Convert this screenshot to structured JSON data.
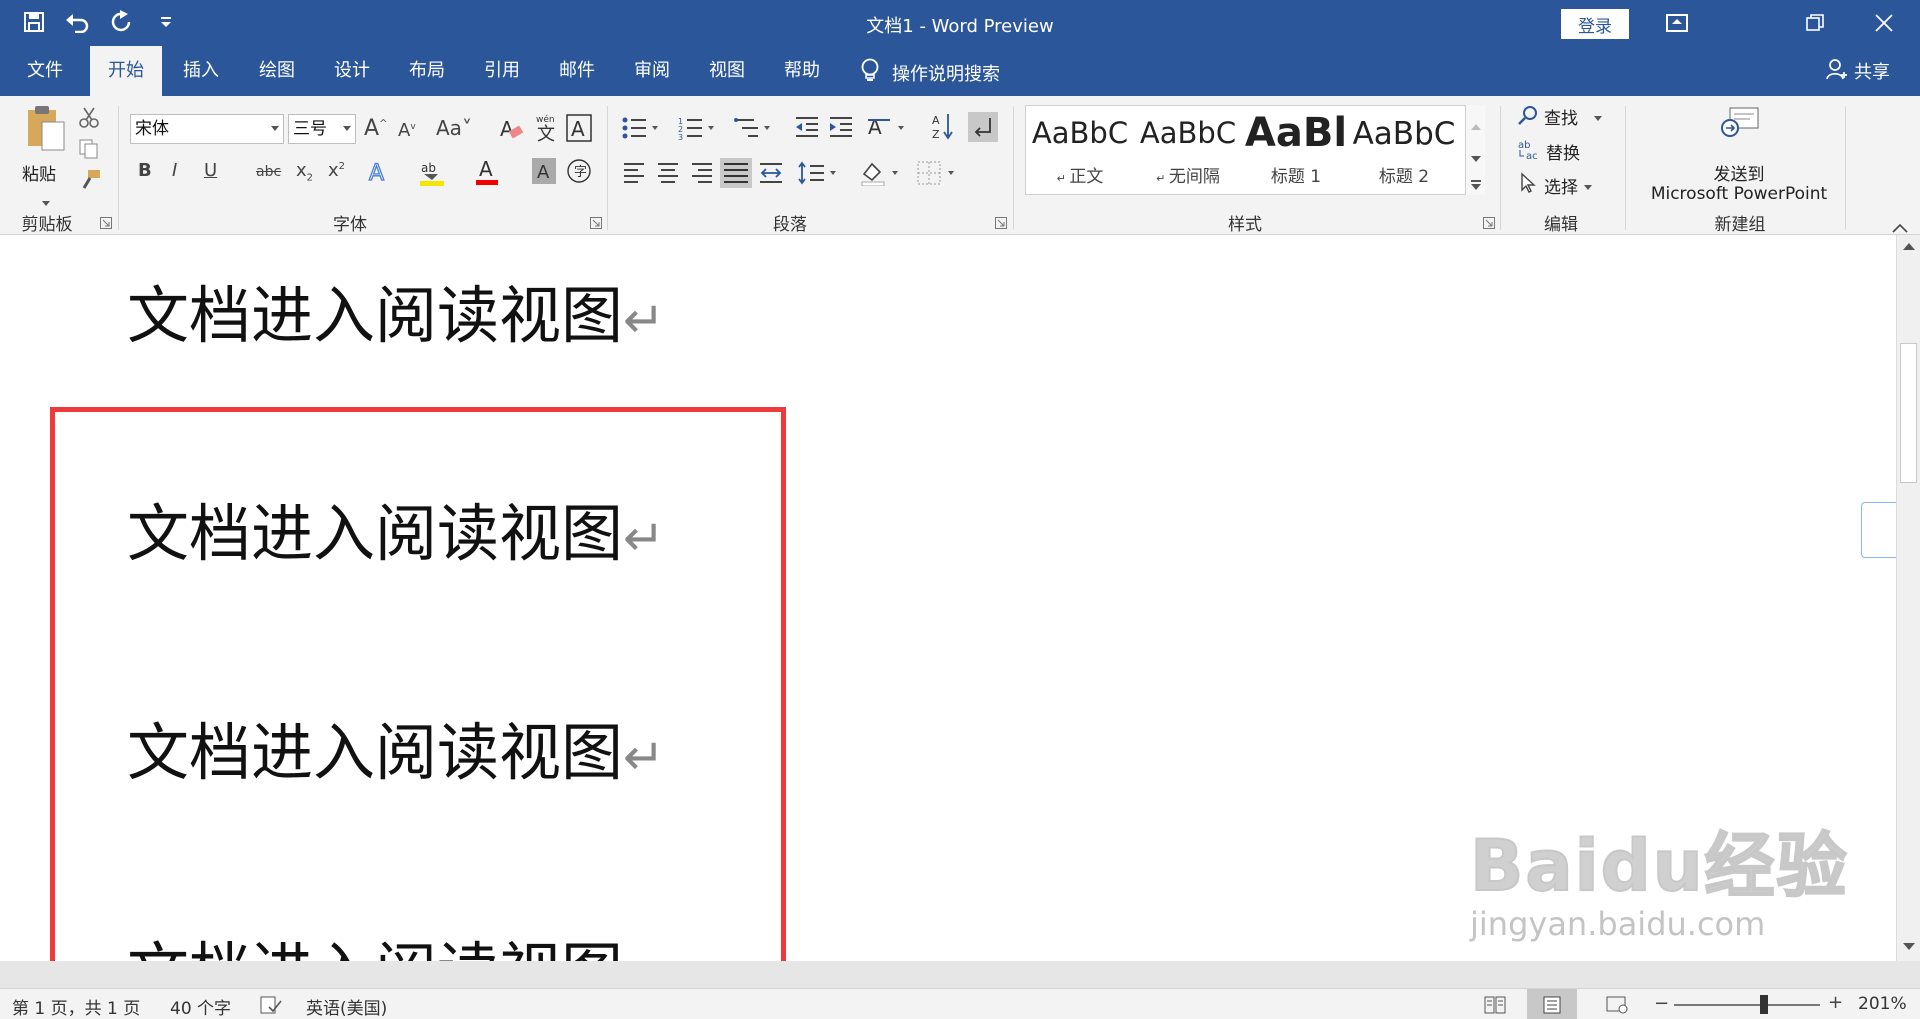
{
  "titlebar": {
    "title": "文档1  -  Word Preview",
    "login": "登录",
    "qat_icons": [
      "save-icon",
      "undo-icon",
      "redo-icon",
      "customize-qat-icon"
    ]
  },
  "tabs": [
    "文件",
    "开始",
    "插入",
    "绘图",
    "设计",
    "布局",
    "引用",
    "邮件",
    "审阅",
    "视图",
    "帮助"
  ],
  "active_tab": "开始",
  "tell_me": "操作说明搜索",
  "share": "共享",
  "ribbon": {
    "clipboard": {
      "paste": "粘贴",
      "label": "剪贴板"
    },
    "font": {
      "name": "宋体",
      "size": "三号",
      "label": "字体",
      "change_case": "Aa"
    },
    "paragraph": {
      "label": "段落"
    },
    "styles": {
      "label": "样式",
      "items": [
        {
          "preview": "AaBbC",
          "name": "正文"
        },
        {
          "preview": "AaBbC",
          "name": "无间隔"
        },
        {
          "preview": "AaBl",
          "name": "标题 1"
        },
        {
          "preview": "AaBbC",
          "name": "标题 2"
        }
      ]
    },
    "editing": {
      "find": "查找",
      "replace": "替换",
      "select": "选择",
      "label": "编辑"
    },
    "newgroup": {
      "send_line1": "发送到",
      "send_line2": "Microsoft PowerPoint",
      "label": "新建组"
    }
  },
  "document": {
    "lines": [
      "文档进入阅读视图",
      "文档进入阅读视图",
      "文档进入阅读视图",
      "文档进入阅读视图"
    ]
  },
  "status": {
    "page": "第 1 页，共 1 页",
    "words": "40 个字",
    "language": "英语(美国)",
    "zoom": "201%"
  },
  "watermark": {
    "logo": "Baidu经验",
    "url": "jingyan.baidu.com"
  },
  "colors": {
    "brand": "#2b579a",
    "highlight_box": "#ee3a3a"
  }
}
